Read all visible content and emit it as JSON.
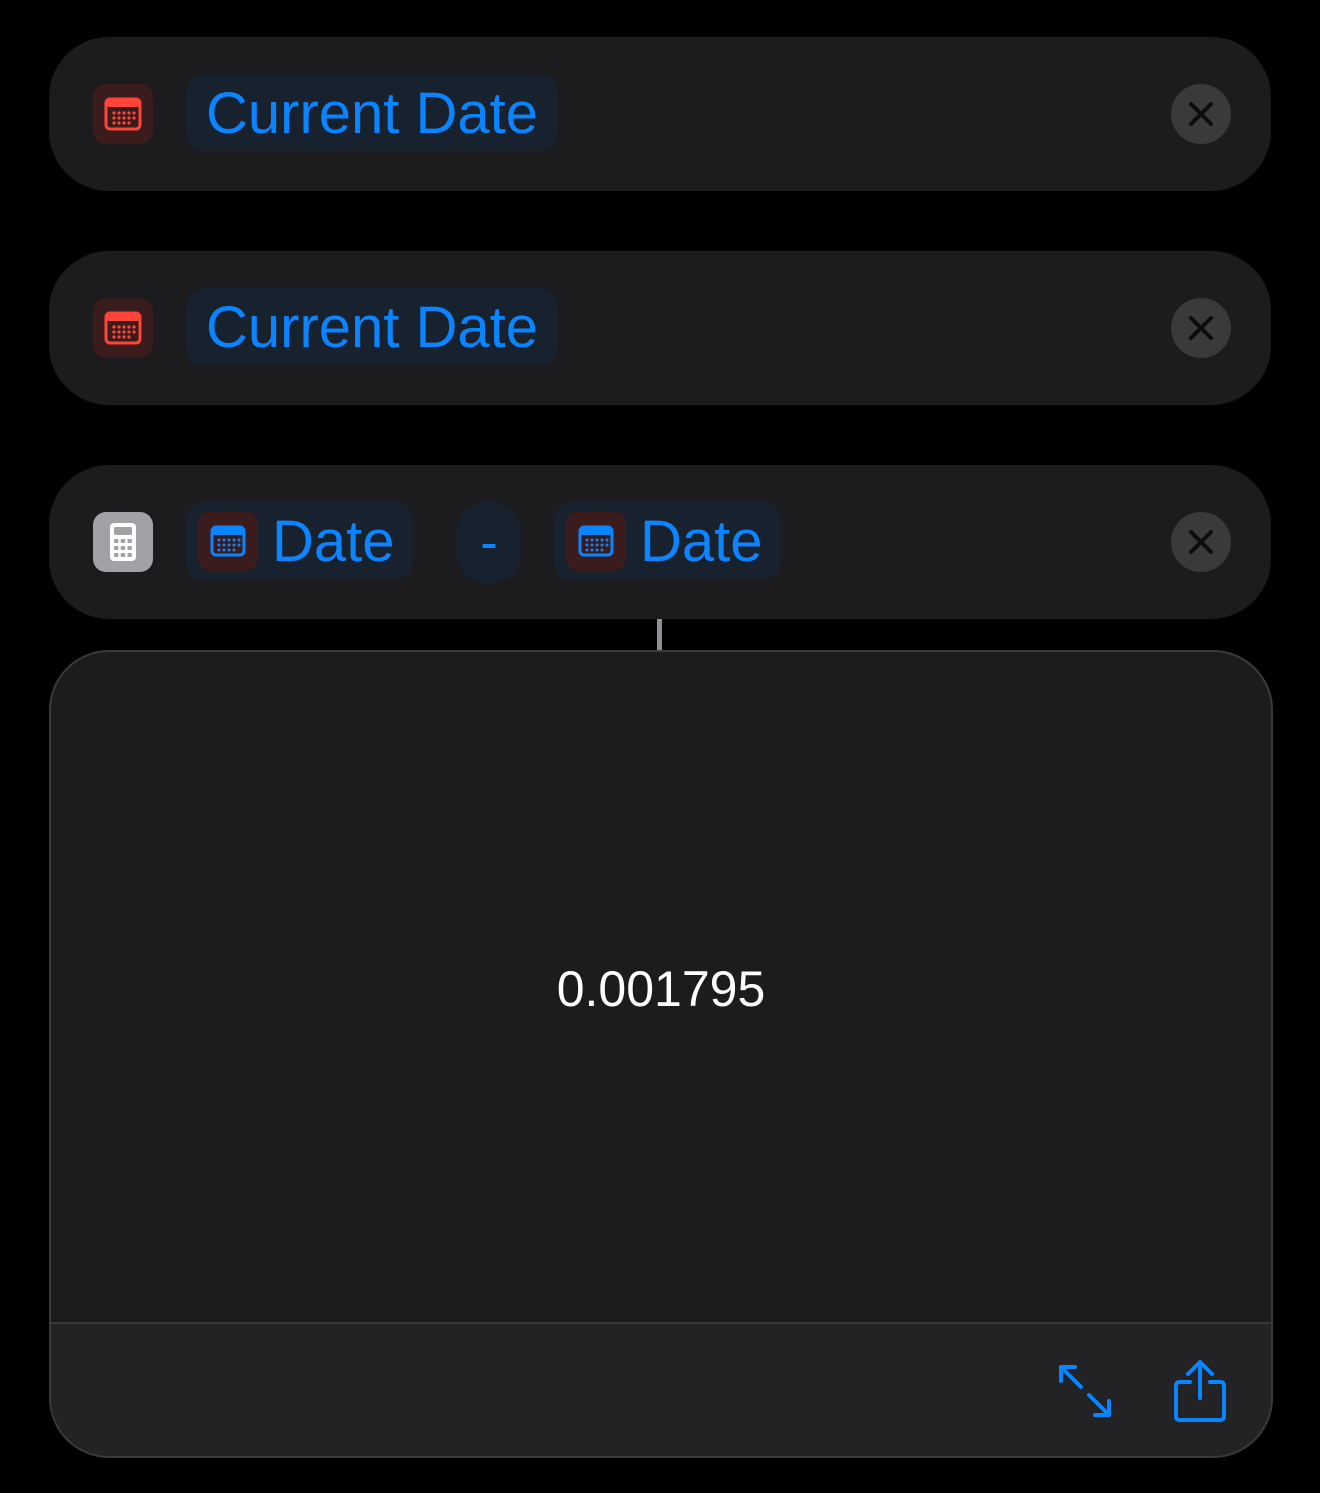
{
  "actions": [
    {
      "app_icon": "calendar-icon",
      "token_label": "Current Date",
      "remove_icon": "close-icon"
    },
    {
      "app_icon": "calendar-icon",
      "token_label": "Current Date",
      "remove_icon": "close-icon"
    },
    {
      "app_icon": "calculator-icon",
      "operand_a": "Date",
      "operator": "-",
      "operand_b": "Date",
      "remove_icon": "close-icon"
    }
  ],
  "result": {
    "value": "0.001795",
    "toolbar": {
      "expand_icon": "expand-icon",
      "share_icon": "share-icon"
    }
  },
  "colors": {
    "background": "#000000",
    "card": "#1c1c1e",
    "accent": "#0a84ff",
    "calendar_red": "#ff453a",
    "token_bg": "#18212e",
    "close_bg": "#3a3a3c"
  }
}
